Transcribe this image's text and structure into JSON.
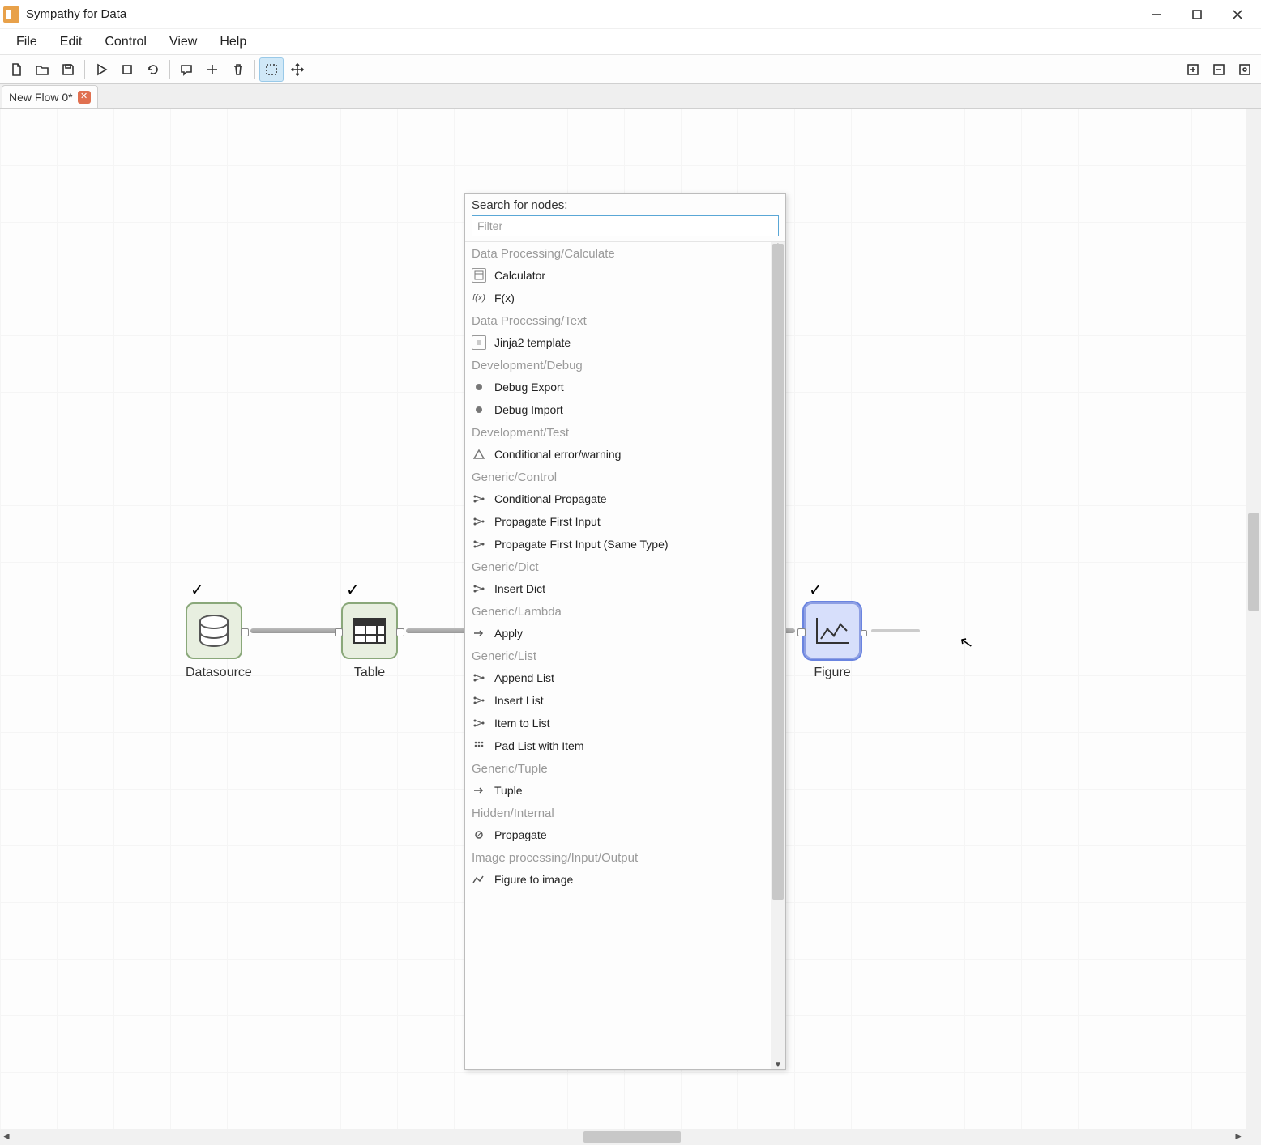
{
  "app": {
    "title": "Sympathy for Data"
  },
  "menu": {
    "file": "File",
    "edit": "Edit",
    "control": "Control",
    "view": "View",
    "help": "Help"
  },
  "tab": {
    "name": "New Flow 0*"
  },
  "nodes": {
    "datasource": "Datasource",
    "table": "Table",
    "figure": "Figure"
  },
  "popup": {
    "label": "Search for nodes:",
    "placeholder": "Filter",
    "groups": [
      {
        "cat": "Data Processing/Calculate",
        "items": [
          {
            "icon": "calc",
            "label": "Calculator"
          },
          {
            "icon": "fx",
            "label": "F(x)"
          }
        ]
      },
      {
        "cat": "Data Processing/Text",
        "items": [
          {
            "icon": "box",
            "label": "Jinja2 template"
          }
        ]
      },
      {
        "cat": "Development/Debug",
        "items": [
          {
            "icon": "dot",
            "label": "Debug Export"
          },
          {
            "icon": "dot",
            "label": "Debug Import"
          }
        ]
      },
      {
        "cat": "Development/Test",
        "items": [
          {
            "icon": "tri",
            "label": "Conditional error/warning"
          }
        ]
      },
      {
        "cat": "Generic/Control",
        "items": [
          {
            "icon": "dots",
            "label": "Conditional Propagate"
          },
          {
            "icon": "dots",
            "label": "Propagate First Input"
          },
          {
            "icon": "dots",
            "label": "Propagate First Input (Same Type)"
          }
        ]
      },
      {
        "cat": "Generic/Dict",
        "items": [
          {
            "icon": "dots",
            "label": "Insert Dict"
          }
        ]
      },
      {
        "cat": "Generic/Lambda",
        "items": [
          {
            "icon": "arr",
            "label": "Apply"
          }
        ]
      },
      {
        "cat": "Generic/List",
        "items": [
          {
            "icon": "dots",
            "label": "Append List"
          },
          {
            "icon": "dots",
            "label": "Insert List"
          },
          {
            "icon": "dots",
            "label": "Item to List"
          },
          {
            "icon": "grid",
            "label": "Pad List with Item"
          }
        ]
      },
      {
        "cat": "Generic/Tuple",
        "items": [
          {
            "icon": "arr",
            "label": "Tuple"
          }
        ]
      },
      {
        "cat": "Hidden/Internal",
        "items": [
          {
            "icon": "circ",
            "label": "Propagate"
          }
        ]
      },
      {
        "cat": "Image processing/Input/Output",
        "items": [
          {
            "icon": "img",
            "label": "Figure to image"
          }
        ]
      }
    ]
  }
}
